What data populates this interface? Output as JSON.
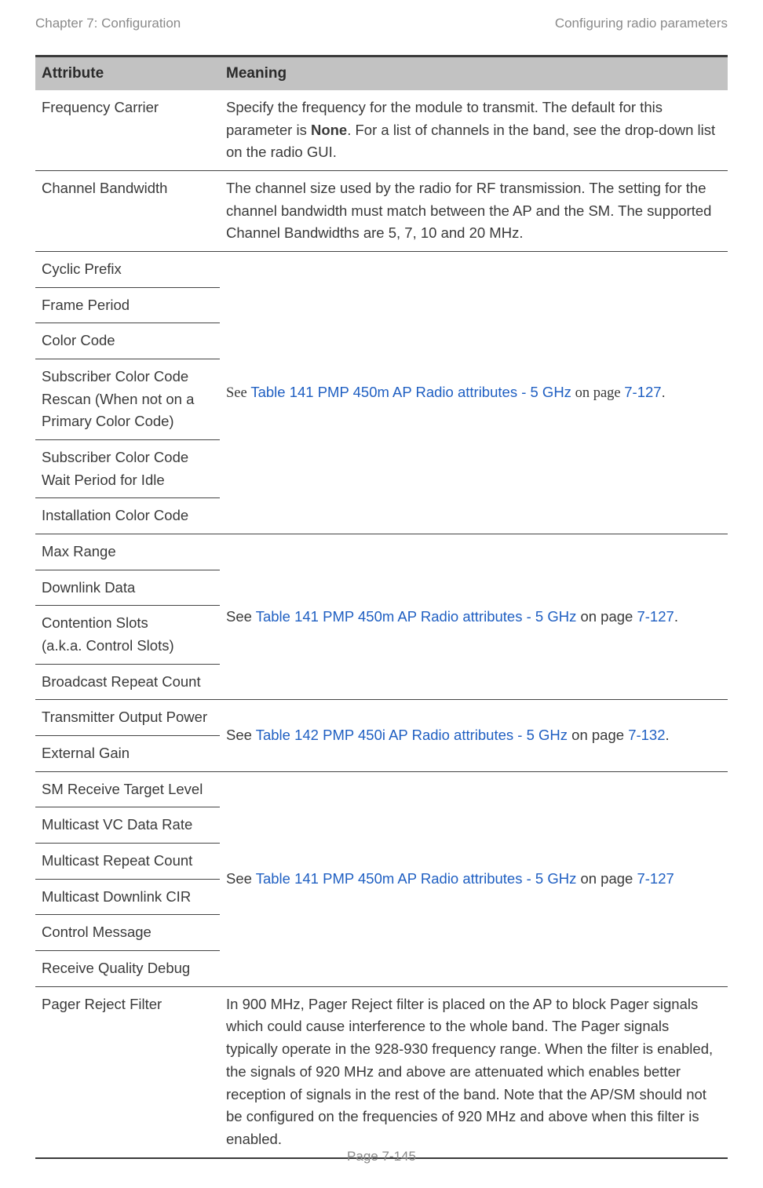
{
  "header": {
    "left": "Chapter 7:  Configuration",
    "right": "Configuring radio parameters"
  },
  "table": {
    "head": {
      "attr": "Attribute",
      "mean": "Meaning"
    },
    "freq_carrier": {
      "attr": "Frequency Carrier",
      "mean_pre": "Specify the frequency for the module to transmit. The default for this parameter is ",
      "mean_bold": "None",
      "mean_post": ". For a list of channels in the band, see the drop-down list on the radio GUI."
    },
    "chan_bw": {
      "attr": "Channel Bandwidth",
      "mean": "The channel size used by the radio for RF transmission. The setting for the channel bandwidth must match between the AP and the SM. The supported Channel Bandwidths are 5, 7, 10 and 20 MHz."
    },
    "group1": {
      "attrs": [
        "Cyclic Prefix",
        "Frame Period",
        "Color Code",
        "Subscriber Color Code Rescan (When not on a Primary Color Code)",
        "Subscriber Color Code Wait Period for Idle",
        "Installation Color Code"
      ],
      "mean_see": "See ",
      "mean_link": "Table 141 PMP 450m AP Radio attributes - 5 GHz",
      "mean_onpage": " on page ",
      "mean_pagelink": "7-127",
      "mean_period": "."
    },
    "group2": {
      "attrs": [
        "Max Range",
        "Downlink Data",
        "Contention Slots",
        "(a.k.a. Control Slots)",
        "Broadcast Repeat Count"
      ],
      "mean_see": "See ",
      "mean_link": "Table 141 PMP 450m AP Radio attributes - 5 GHz",
      "mean_onpage": " on page ",
      "mean_pagelink": "7-127",
      "mean_period": "."
    },
    "group3": {
      "attrs": [
        "Transmitter Output Power",
        "External Gain"
      ],
      "mean_see": "See ",
      "mean_link": "Table 142 PMP 450i AP Radio attributes - 5 GHz ",
      "mean_onpage": " on page ",
      "mean_pagelink": "7-132",
      "mean_period": "."
    },
    "group4": {
      "attrs": [
        "SM Receive Target Level",
        "Multicast VC Data Rate",
        "Multicast Repeat Count",
        "Multicast Downlink CIR",
        "Control Message",
        "Receive Quality Debug"
      ],
      "mean_see": "See ",
      "mean_link": "Table 141 PMP 450m AP Radio attributes - 5 GHz",
      "mean_onpage": " on page ",
      "mean_pagelink": "7-127"
    },
    "pager": {
      "attr": "Pager Reject Filter",
      "mean": "In 900 MHz, Pager Reject filter is placed on the AP to block Pager signals which could cause interference to the whole band. The Pager signals typically operate in the 928-930 frequency range. When the filter is enabled, the signals of 920 MHz and above are attenuated which enables better reception of signals in the rest of the band. Note that the AP/SM should not be configured on the frequencies of 920 MHz and above when this filter is enabled."
    }
  },
  "chart_data": {
    "type": "table",
    "title": "Attribute / Meaning",
    "columns": [
      "Attribute",
      "Meaning"
    ],
    "rows": [
      [
        "Frequency Carrier",
        "Specify the frequency for the module to transmit. The default for this parameter is None. For a list of channels in the band, see the drop-down list on the radio GUI."
      ],
      [
        "Channel Bandwidth",
        "The channel size used by the radio for RF transmission. The setting for the channel bandwidth must match between the AP and the SM. The supported Channel Bandwidths are 5, 7, 10 and 20 MHz."
      ],
      [
        "Cyclic Prefix",
        "See Table 141 PMP 450m AP Radio attributes - 5 GHz on page 7-127."
      ],
      [
        "Frame Period",
        "See Table 141 PMP 450m AP Radio attributes - 5 GHz on page 7-127."
      ],
      [
        "Color Code",
        "See Table 141 PMP 450m AP Radio attributes - 5 GHz on page 7-127."
      ],
      [
        "Subscriber Color Code Rescan (When not on a Primary Color Code)",
        "See Table 141 PMP 450m AP Radio attributes - 5 GHz on page 7-127."
      ],
      [
        "Subscriber Color Code Wait Period for Idle",
        "See Table 141 PMP 450m AP Radio attributes - 5 GHz on page 7-127."
      ],
      [
        "Installation Color Code",
        "See Table 141 PMP 450m AP Radio attributes - 5 GHz on page 7-127."
      ],
      [
        "Max Range",
        "See Table 141 PMP 450m AP Radio attributes - 5 GHz on page 7-127."
      ],
      [
        "Downlink Data",
        "See Table 141 PMP 450m AP Radio attributes - 5 GHz on page 7-127."
      ],
      [
        "Contention Slots (a.k.a. Control Slots)",
        "See Table 141 PMP 450m AP Radio attributes - 5 GHz on page 7-127."
      ],
      [
        "Broadcast Repeat Count",
        "See Table 141 PMP 450m AP Radio attributes - 5 GHz on page 7-127."
      ],
      [
        "Transmitter Output Power",
        "See Table 142 PMP 450i AP Radio attributes - 5 GHz on page 7-132."
      ],
      [
        "External Gain",
        "See Table 142 PMP 450i AP Radio attributes - 5 GHz on page 7-132."
      ],
      [
        "SM Receive Target Level",
        "See Table 141 PMP 450m AP Radio attributes - 5 GHz on page 7-127"
      ],
      [
        "Multicast VC Data Rate",
        "See Table 141 PMP 450m AP Radio attributes - 5 GHz on page 7-127"
      ],
      [
        "Multicast Repeat Count",
        "See Table 141 PMP 450m AP Radio attributes - 5 GHz on page 7-127"
      ],
      [
        "Multicast Downlink CIR",
        "See Table 141 PMP 450m AP Radio attributes - 5 GHz on page 7-127"
      ],
      [
        "Control Message",
        "See Table 141 PMP 450m AP Radio attributes - 5 GHz on page 7-127"
      ],
      [
        "Receive Quality Debug",
        "See Table 141 PMP 450m AP Radio attributes - 5 GHz on page 7-127"
      ],
      [
        "Pager Reject Filter",
        "In 900 MHz, Pager Reject filter is placed on the AP to block Pager signals which could cause interference to the whole band. The Pager signals typically operate in the 928-930 frequency range. When the filter is enabled, the signals of 920 MHz and above are attenuated which enables better reception of signals in the rest of the band. Note that the AP/SM should not be configured on the frequencies of 920 MHz and above when this filter is enabled."
      ]
    ]
  },
  "footer": "Page 7-145"
}
